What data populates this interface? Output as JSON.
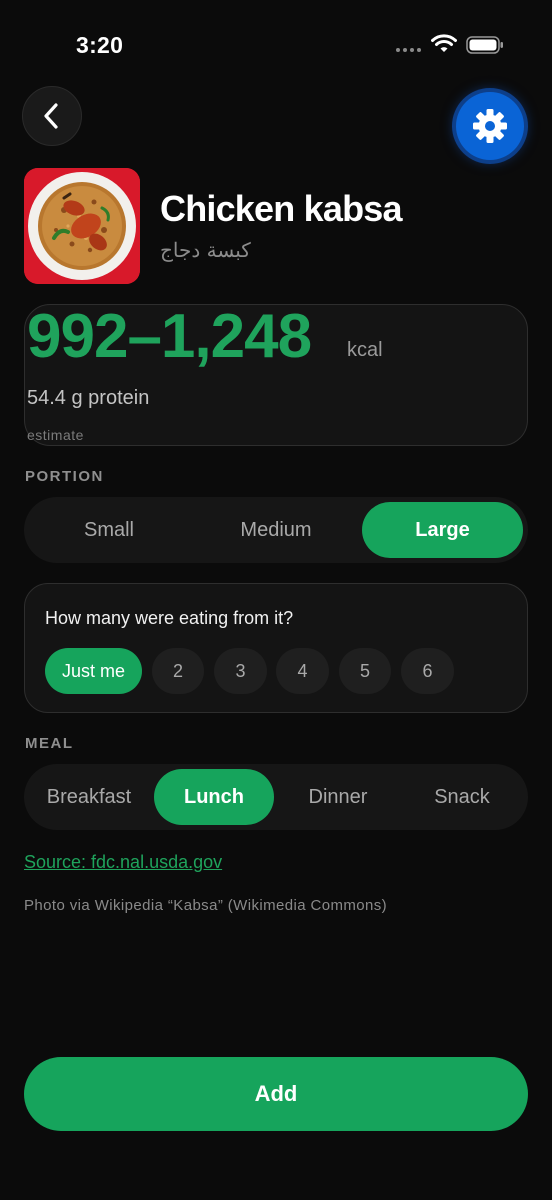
{
  "status_bar": {
    "time": "3:20",
    "signal_icon": "signal-dots-icon",
    "wifi_icon": "wifi-icon",
    "battery_icon": "battery-icon"
  },
  "nav": {
    "back_icon": "chevron-left-icon",
    "settings_icon": "gear-icon",
    "accent_color": "#0a64d6"
  },
  "food": {
    "title": "Chicken kabsa",
    "subtitle": "كبسة دجاج",
    "image": "kabsa-dish-photo"
  },
  "calories": {
    "range": "992–1,248",
    "unit": "kcal",
    "protein": "54.4 g protein",
    "note": "estimate",
    "color": "#1fa35c"
  },
  "portion": {
    "label": "PORTION",
    "options": [
      "Small",
      "Medium",
      "Large"
    ],
    "selected": "Large"
  },
  "sharing": {
    "question": "How many were eating from it?",
    "options": [
      "Just me",
      "2",
      "3",
      "4",
      "5",
      "6"
    ],
    "selected": "Just me"
  },
  "meal": {
    "label": "MEAL",
    "options": [
      "Breakfast",
      "Lunch",
      "Dinner",
      "Snack"
    ],
    "selected": "Lunch"
  },
  "source_link": "Source: fdc.nal.usda.gov",
  "photo_credit": "Photo via Wikipedia “Kabsa” (Wikimedia Commons)",
  "add_button": "Add",
  "accent_green": "#16a45c"
}
